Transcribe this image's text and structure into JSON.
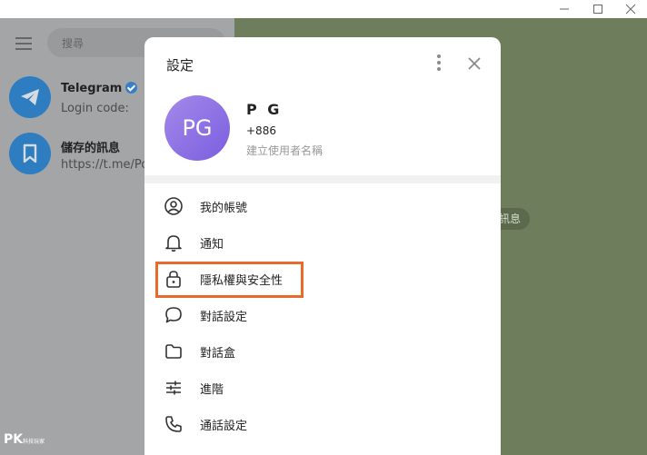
{
  "window": {
    "minimize_icon": "minimize-icon",
    "maximize_icon": "maximize-icon",
    "close_icon": "window-close-icon"
  },
  "sidebar": {
    "search_placeholder": "搜尋",
    "chats": [
      {
        "name": "Telegram",
        "preview": "Login code: ",
        "verified": true,
        "icon": "telegram-plane-icon"
      },
      {
        "name": "儲存的訊息",
        "preview": "https://t.me/Po",
        "icon": "bookmark-icon"
      }
    ]
  },
  "chat_area": {
    "pill_text": "訊息"
  },
  "settings": {
    "title": "設定",
    "profile": {
      "initials": "PG",
      "name": "P G",
      "phone": "+886",
      "username_hint": "建立使用者名稱"
    },
    "menu": [
      {
        "label": "我的帳號",
        "icon": "user-circle-icon"
      },
      {
        "label": "通知",
        "icon": "bell-icon"
      },
      {
        "label": "隱私權與安全性",
        "icon": "lock-icon",
        "highlighted": true
      },
      {
        "label": "對話設定",
        "icon": "chat-bubble-icon"
      },
      {
        "label": "對話盒",
        "icon": "folder-icon"
      },
      {
        "label": "進階",
        "icon": "sliders-icon"
      },
      {
        "label": "通話設定",
        "icon": "phone-icon"
      }
    ],
    "highlight_color": "#ea6a2b"
  },
  "watermark": {
    "brand": "PK",
    "tagline": "科技玩家"
  }
}
